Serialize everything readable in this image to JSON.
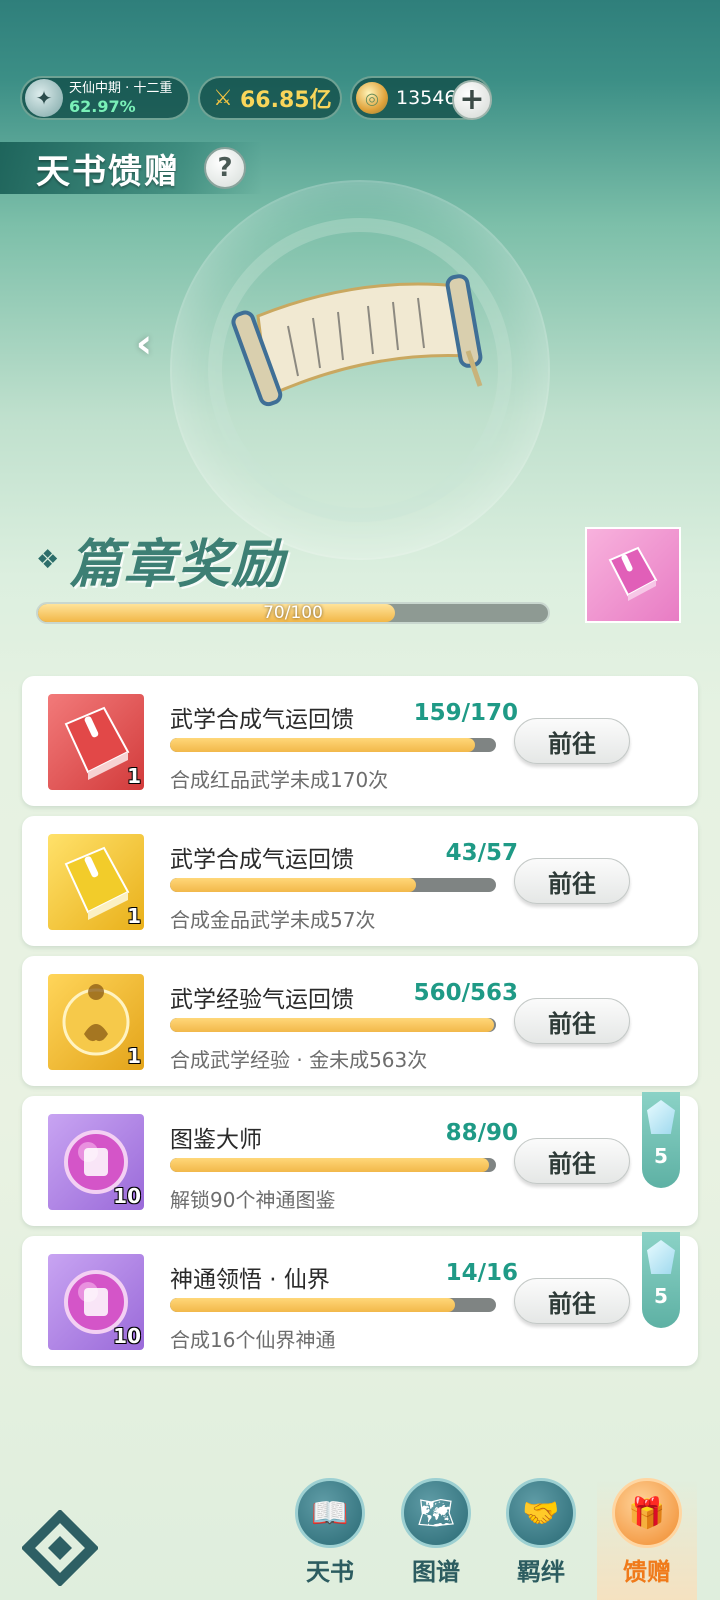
{
  "status": {
    "rank": "天仙中期 · 十二重",
    "rank_percent": "62.97%",
    "power": "66.85亿",
    "coins": "13546",
    "plus_symbol": "+"
  },
  "page": {
    "title": "天书馈赠",
    "help_symbol": "?"
  },
  "chapter": {
    "title": "篇章奖励",
    "progress_text": "70/100",
    "progress_fraction": 0.7
  },
  "tasks": [
    {
      "name": "武学合成气运回馈",
      "progress": "159/170",
      "fraction": 0.935,
      "desc": "合成红品武学未成170次",
      "count": "1",
      "button": "前往",
      "icon": "red-book"
    },
    {
      "name": "武学合成气运回馈",
      "progress": "43/57",
      "fraction": 0.754,
      "desc": "合成金品武学未成57次",
      "count": "1",
      "button": "前往",
      "icon": "gold-book"
    },
    {
      "name": "武学经验气运回馈",
      "progress": "560/563",
      "fraction": 0.995,
      "desc": "合成武学经验 · 金未成563次",
      "count": "1",
      "button": "前往",
      "icon": "gold-orb"
    },
    {
      "name": "图鉴大师",
      "progress": "88/90",
      "fraction": 0.978,
      "desc": "解锁90个神通图鉴",
      "count": "10",
      "button": "前往",
      "icon": "purple-orb",
      "tag": "5"
    },
    {
      "name": "神通领悟 · 仙界",
      "progress": "14/16",
      "fraction": 0.875,
      "desc": "合成16个仙界神通",
      "count": "10",
      "button": "前往",
      "icon": "purple-orb",
      "tag": "5"
    }
  ],
  "nav": {
    "items": [
      "天书",
      "图谱",
      "羁绊",
      "馈赠"
    ],
    "active": "馈赠"
  }
}
